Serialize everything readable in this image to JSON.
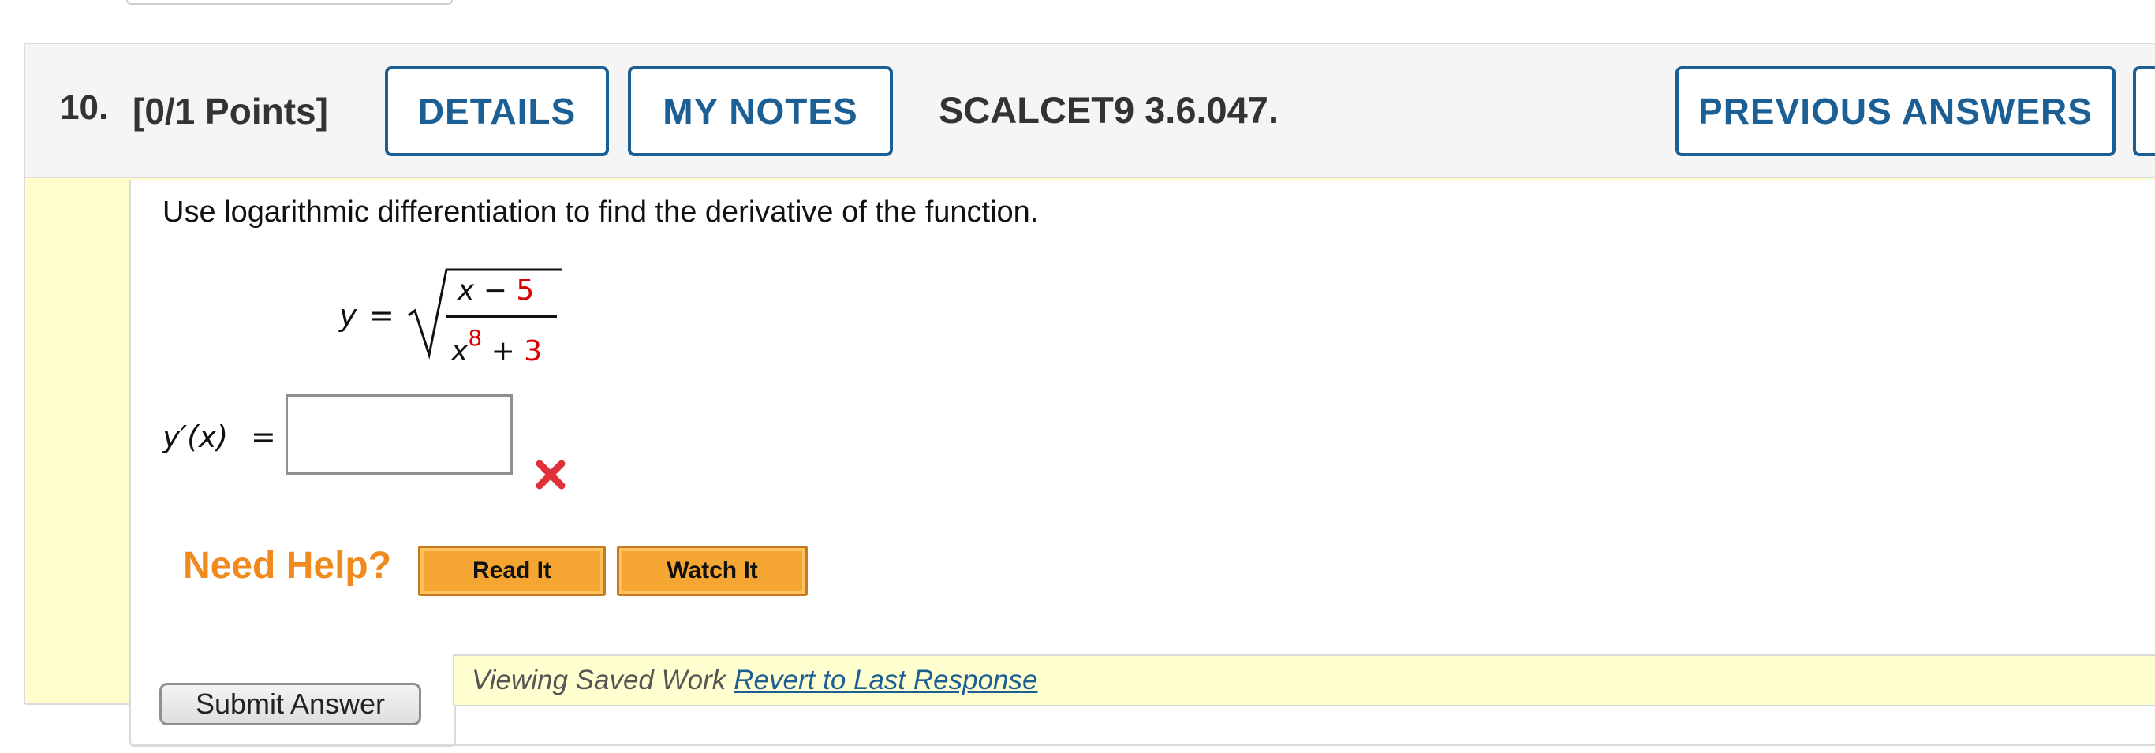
{
  "question": {
    "number": "10.",
    "points": "[0/1 Points]",
    "code": "SCALCET9 3.6.047.",
    "buttons": {
      "details": "DETAILS",
      "my_notes": "MY NOTES",
      "previous_answers": "PREVIOUS ANSWERS"
    }
  },
  "prompt": "Use logarithmic differentiation to find the derivative of the function.",
  "equation": {
    "lhs": "y",
    "equals": "=",
    "numerator_var": "x",
    "numerator_op": "−",
    "numerator_const": "5",
    "denominator_var": "x",
    "denominator_exp": "8",
    "denominator_op": "+",
    "denominator_const": "3"
  },
  "answer": {
    "label": "y′(x)",
    "equals": "=",
    "value": "",
    "status_icon": "incorrect-x-icon"
  },
  "help": {
    "title": "Need Help?",
    "read_it": "Read It",
    "watch_it": "Watch It"
  },
  "saved": {
    "text": "Viewing Saved Work",
    "link": "Revert to Last Response"
  },
  "submit_label": "Submit Answer",
  "colors": {
    "accent_blue": "#1b5f94",
    "highlight_yellow": "#fffdcc",
    "help_orange": "#f08a1c",
    "error_red": "#e0303a",
    "value_red": "#dd0000"
  }
}
